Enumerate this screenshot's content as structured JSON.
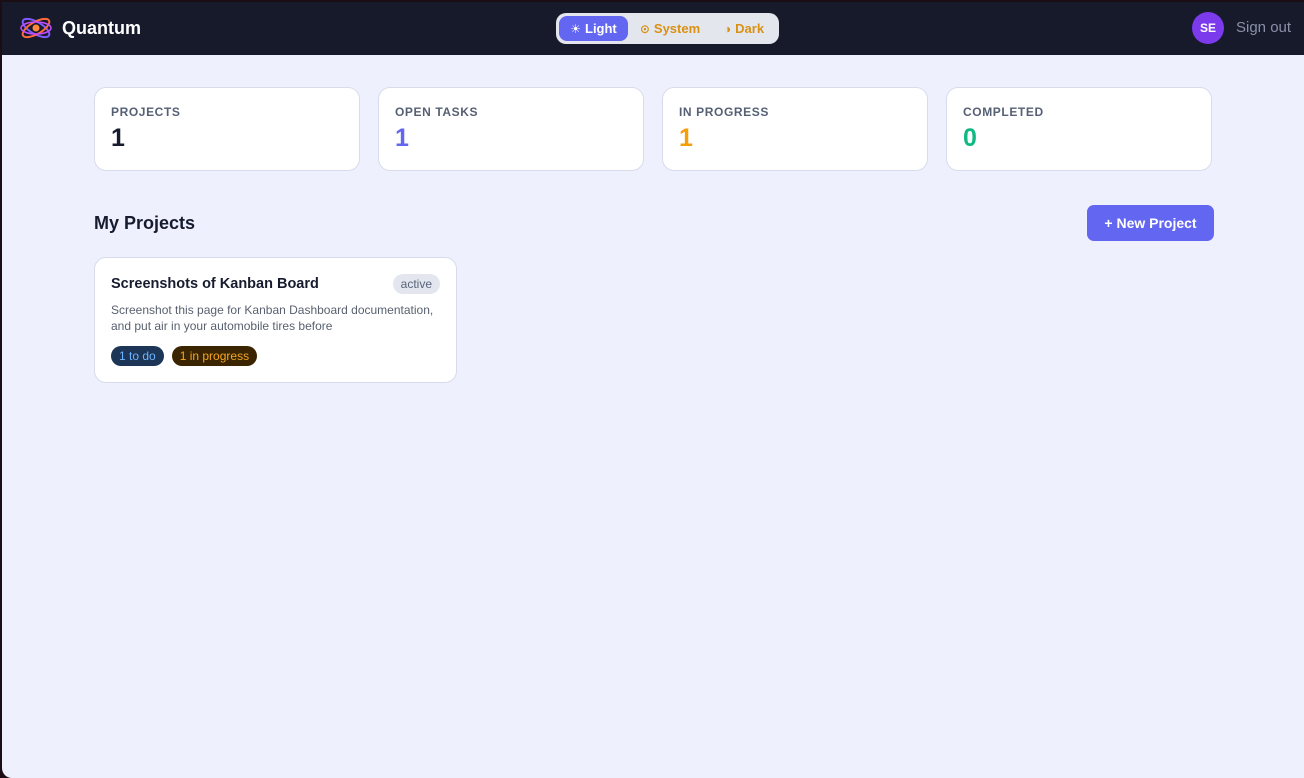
{
  "app": {
    "name": "Quantum"
  },
  "theme_switch": {
    "options": [
      {
        "label": "Light",
        "icon": "sun-icon",
        "glyph": "☀"
      },
      {
        "label": "System",
        "icon": "system-icon",
        "glyph": "⊙"
      },
      {
        "label": "Dark",
        "icon": "half-moon-icon",
        "glyph": "◑"
      }
    ],
    "selected": "Light"
  },
  "user": {
    "initials": "SE",
    "sign_out_label": "Sign out"
  },
  "stats": [
    {
      "label": "PROJECTS",
      "value": "1",
      "color": "#161b2e"
    },
    {
      "label": "OPEN TASKS",
      "value": "1",
      "color": "#6366f1"
    },
    {
      "label": "IN PROGRESS",
      "value": "1",
      "color": "#f59e0b"
    },
    {
      "label": "COMPLETED",
      "value": "0",
      "color": "#10b981"
    }
  ],
  "projects_section": {
    "title": "My Projects",
    "new_button_label": "+ New Project",
    "projects": [
      {
        "title": "Screenshots of Kanban Board",
        "status": "active",
        "description": "Screenshot this page for Kanban Dashboard documentation, and put air in your automobile tires before",
        "chips": [
          {
            "label": "1 to do",
            "kind": "todo"
          },
          {
            "label": "1 in progress",
            "kind": "progress"
          }
        ]
      }
    ]
  },
  "colors": {
    "accent": "#6366f1",
    "topbar_bg": "#171a2b",
    "page_bg": "#eef1fd",
    "avatar_bg": "#7c3aed",
    "theme_text": "#d99114"
  }
}
